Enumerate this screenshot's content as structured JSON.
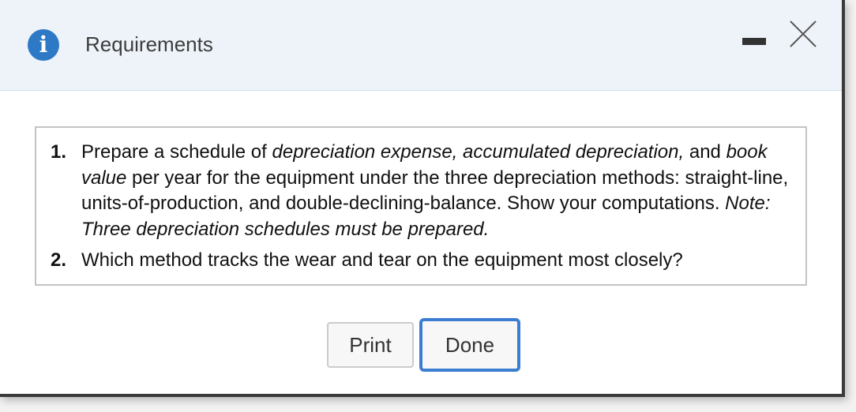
{
  "dialog": {
    "title": "Requirements",
    "minimize_icon": "minimize-icon",
    "close_icon": "close-icon",
    "info_icon": "info-icon",
    "info_glyph": "i",
    "accent_color": "#2e79c5"
  },
  "requirements": [
    {
      "number": "1.",
      "parts": [
        "Prepare a schedule of ",
        "depreciation expense, accumulated depreciation,",
        " and ",
        "book value",
        " per year for the equipment under the three depreciation methods: straight-line, units-of-production, and double-declining-balance. Show your computations. ",
        "Note: Three depreciation schedules must be prepared."
      ]
    },
    {
      "number": "2.",
      "text": "Which method tracks the wear and tear on the equipment most closely?"
    }
  ],
  "buttons": {
    "print_label": "Print",
    "done_label": "Done"
  }
}
